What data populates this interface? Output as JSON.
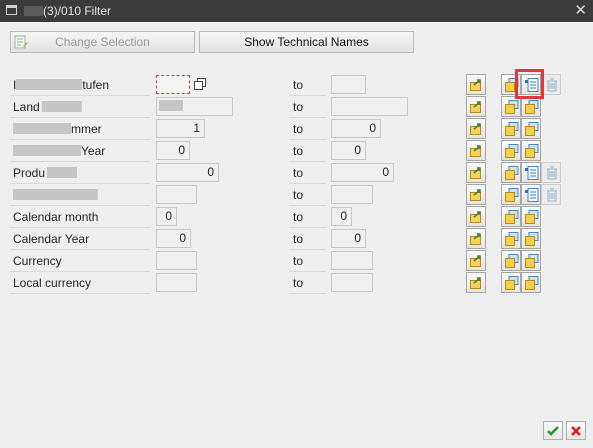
{
  "window": {
    "title": "(3)/010 Filter",
    "close_glyph": "✕"
  },
  "toolbar": {
    "change_selection_label": "Change Selection",
    "show_technical_names_label": "Show Technical Names"
  },
  "to_label": "to",
  "rows": [
    {
      "label_start": "I",
      "label_end": "tufen",
      "low": "",
      "high": ""
    },
    {
      "label_start": "Land",
      "label_end": "",
      "low": "",
      "high": ""
    },
    {
      "label_start": "",
      "label_end": "mmer",
      "low": "1",
      "high": "0"
    },
    {
      "label_start": "",
      "label_end": "Year",
      "low": "0",
      "high": "0"
    },
    {
      "label_start": "Produ",
      "label_end": "",
      "low": "0",
      "high": "0"
    },
    {
      "label_start": "",
      "label_end": "",
      "low": "",
      "high": ""
    },
    {
      "label_start": "Calendar month",
      "label_end": "",
      "low": "0",
      "high": "0"
    },
    {
      "label_start": "Calendar Year",
      "label_end": "",
      "low": "0",
      "high": "0"
    },
    {
      "label_start": "Currency",
      "label_end": "",
      "low": "",
      "high": ""
    },
    {
      "label_start": "Local currency",
      "label_end": "",
      "low": "",
      "high": ""
    }
  ],
  "icons": {
    "multiple": "multiple-selection-icon",
    "select_single": "select-single-values-icon",
    "hierarchy": "hierarchy-icon",
    "delete": "delete-trash-icon",
    "confirm": "green-check-icon",
    "cancel": "red-x-icon"
  },
  "colors": {
    "titlebar": "#3b3b3b",
    "highlight": "#e0393c",
    "confirm": "#2a9a2a",
    "cancel": "#d42020"
  }
}
